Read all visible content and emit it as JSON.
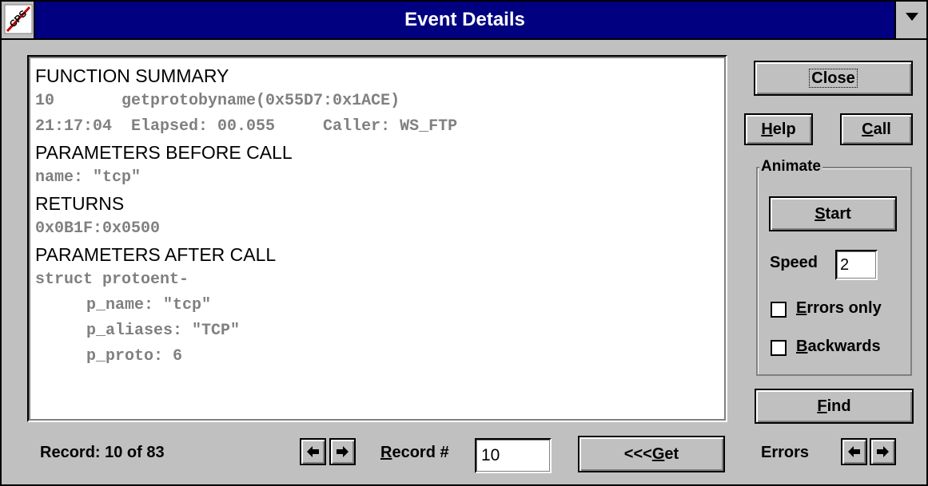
{
  "window": {
    "title": "Event Details",
    "icon": "cps-icon",
    "icon_text": "CPS"
  },
  "details": {
    "lines": [
      {
        "kind": "header",
        "text": "FUNCTION SUMMARY"
      },
      {
        "kind": "value",
        "text": "10       getprotobyname(0x55D7:0x1ACE)"
      },
      {
        "kind": "value",
        "text": "21:17:04  Elapsed: 00.055     Caller: WS_FTP"
      },
      {
        "kind": "header",
        "text": "PARAMETERS BEFORE CALL"
      },
      {
        "kind": "value",
        "text": "name: \"tcp\""
      },
      {
        "kind": "header",
        "text": "RETURNS"
      },
      {
        "kind": "value",
        "text": "0x0B1F:0x0500"
      },
      {
        "kind": "header",
        "text": "PARAMETERS AFTER CALL"
      },
      {
        "kind": "value",
        "text": "struct protoent-"
      },
      {
        "kind": "value",
        "indent": true,
        "text": "p_name: \"tcp\""
      },
      {
        "kind": "value",
        "indent": true,
        "text": "p_aliases: \"TCP\""
      },
      {
        "kind": "value",
        "indent": true,
        "text": "p_proto: 6"
      }
    ]
  },
  "buttons": {
    "close": "Close",
    "help_accel": "H",
    "help_rest": "elp",
    "call_accel": "C",
    "call_rest": "all",
    "start_accel": "S",
    "start_rest": "tart",
    "find_accel": "F",
    "find_rest": "ind",
    "get_prefix": "<<<",
    "get_accel": "G",
    "get_rest": "et"
  },
  "animate": {
    "label": "Animate",
    "speed_label": "Speed",
    "speed_value": "2",
    "errors_only_accel": "E",
    "errors_only_rest": "rrors only",
    "errors_only_checked": false,
    "backwards_accel": "B",
    "backwards_rest": "ackwards",
    "backwards_checked": false
  },
  "footer": {
    "record_status": "Record: 10 of 83",
    "record_num_accel": "R",
    "record_num_rest": "ecord #",
    "record_num_value": "10",
    "errors_label": "Errors"
  }
}
